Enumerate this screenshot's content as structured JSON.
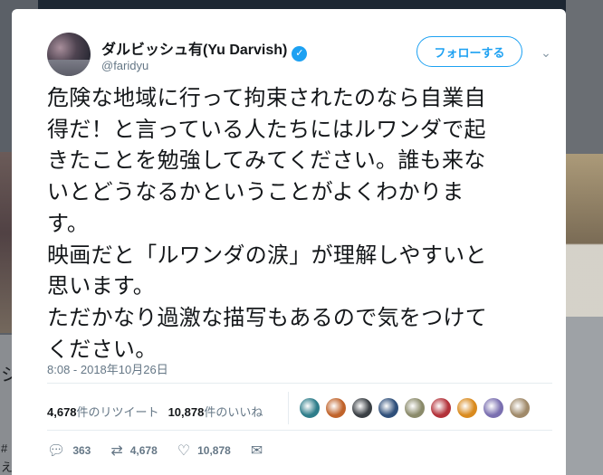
{
  "tweet": {
    "display_name": "ダルビッシュ有(Yu Darvish)",
    "handle": "@faridyu",
    "follow_label": "フォローする",
    "text_lines": [
      "危険な地域に行って拘束されたのなら自業自",
      "得だ！と言っている人たちにはルワンダで起",
      "きたことを勉強してみてください。誰も来な",
      "いとどうなるかということがよくわかりま",
      "す。",
      "映画だと「ルワンダの涙」が理解しやすいと",
      "思います。",
      "ただかなり過激な描写もあるので気をつけて",
      "ください。"
    ],
    "timestamp": "8:08 - 2018年10月26日",
    "retweets_count": "4,678",
    "retweets_label": "件のリツイート",
    "likes_count": "10,878",
    "likes_label": "件のいいね",
    "actions": {
      "reply_count": "363",
      "retweet_count": "4,678",
      "like_count": "10,878"
    },
    "liker_colors": [
      "#2e7d8a",
      "#c0632b",
      "#3a3f44",
      "#2f4f7a",
      "#8a8a6a",
      "#b3323a",
      "#d98a1e",
      "#7a6fb0",
      "#a08a6a"
    ],
    "accent_color": "#1da1f2"
  },
  "background": {
    "left_fragments": [
      "シ",
      "#",
      "え"
    ]
  }
}
